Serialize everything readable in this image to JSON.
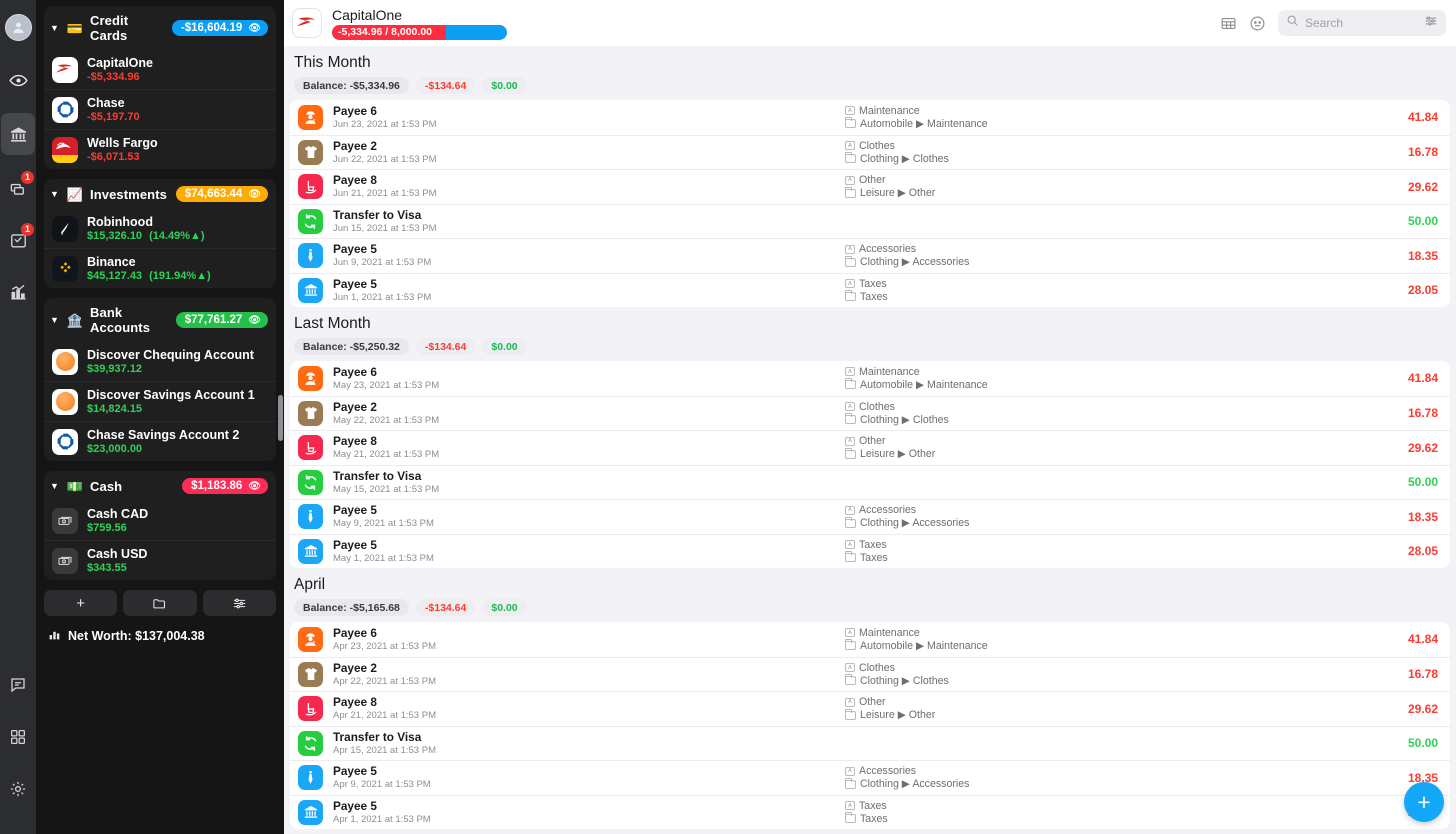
{
  "rail": {
    "avatar": "user-avatar",
    "items": [
      {
        "name": "eye",
        "badge": null
      },
      {
        "name": "bank",
        "badge": null,
        "active": true
      },
      {
        "name": "bills",
        "badge": "1"
      },
      {
        "name": "scheduled",
        "badge": "1"
      },
      {
        "name": "reports",
        "badge": null
      }
    ],
    "bottom": [
      {
        "name": "messages"
      },
      {
        "name": "widgets"
      },
      {
        "name": "settings"
      }
    ]
  },
  "sidebar": {
    "groups": [
      {
        "title": "Credit Cards",
        "emoji": "💳",
        "total": "-$16,604.19",
        "pill_color": "#0a9ff5",
        "accounts": [
          {
            "name": "CapitalOne",
            "balance": "-$5,334.96",
            "sign": "neg",
            "change": "",
            "logo": "capitalone"
          },
          {
            "name": "Chase",
            "balance": "-$5,197.70",
            "sign": "neg",
            "change": "",
            "logo": "chase"
          },
          {
            "name": "Wells Fargo",
            "balance": "-$6,071.53",
            "sign": "neg",
            "change": "",
            "logo": "wellsfargo"
          }
        ]
      },
      {
        "title": "Investments",
        "emoji": "📈",
        "total": "$74,663.44",
        "pill_color": "#ffab00",
        "accounts": [
          {
            "name": "Robinhood",
            "balance": "$15,326.10",
            "sign": "pos",
            "change": "(14.49%▲)",
            "logo": "robinhood"
          },
          {
            "name": "Binance",
            "balance": "$45,127.43",
            "sign": "pos",
            "change": "(191.94%▲)",
            "logo": "binance"
          }
        ]
      },
      {
        "title": "Bank Accounts",
        "emoji": "🏦",
        "total": "$77,761.27",
        "pill_color": "#24c04a",
        "accounts": [
          {
            "name": "Discover Chequing Account",
            "balance": "$39,937.12",
            "sign": "pos",
            "change": "",
            "logo": "discover"
          },
          {
            "name": "Discover Savings Account 1",
            "balance": "$14,824.15",
            "sign": "pos",
            "change": "",
            "logo": "discover"
          },
          {
            "name": "Chase Savings Account 2",
            "balance": "$23,000.00",
            "sign": "pos",
            "change": "",
            "logo": "chase"
          }
        ]
      },
      {
        "title": "Cash",
        "emoji": "💵",
        "total": "$1,183.86",
        "pill_color": "#ff2d55",
        "accounts": [
          {
            "name": "Cash CAD",
            "balance": "$759.56",
            "sign": "pos",
            "change": "",
            "logo": "cash"
          },
          {
            "name": "Cash USD",
            "balance": "$343.55",
            "sign": "pos",
            "change": "",
            "logo": "cash"
          }
        ]
      }
    ],
    "actions": [
      {
        "name": "add-account-button",
        "glyph": "+"
      },
      {
        "name": "folder-button",
        "glyph": "folder"
      },
      {
        "name": "filter-button",
        "glyph": "sliders"
      }
    ],
    "net_worth_label": "Net Worth: $137,004.38"
  },
  "header": {
    "account_name": "CapitalOne",
    "progress_label": "-5,334.96 / 8,000.00",
    "progress_percent": 65,
    "search_placeholder": "Search"
  },
  "sections": [
    {
      "title": "This Month",
      "balance_chip": "Balance: -$5,334.96",
      "spent_chip": "-$134.64",
      "income_chip": "$0.00",
      "transactions": [
        {
          "payee": "Payee 6",
          "date": "Jun 23, 2021 at 1:53 PM",
          "tag": "Maintenance",
          "category": "Automobile ▶ Maintenance",
          "amount": "41.84",
          "sign": "neg",
          "icon": "worker",
          "color": "#ff6a13"
        },
        {
          "payee": "Payee 2",
          "date": "Jun 22, 2021 at 1:53 PM",
          "tag": "Clothes",
          "category": "Clothing ▶ Clothes",
          "amount": "16.78",
          "sign": "neg",
          "icon": "shirt",
          "color": "#9b7b53"
        },
        {
          "payee": "Payee 8",
          "date": "Jun 21, 2021 at 1:53 PM",
          "tag": "Other",
          "category": "Leisure ▶ Other",
          "amount": "29.62",
          "sign": "neg",
          "icon": "chair",
          "color": "#f5294e"
        },
        {
          "payee": "Transfer to Visa",
          "date": "Jun 15, 2021 at 1:53 PM",
          "tag": "",
          "category": "",
          "amount": "50.00",
          "sign": "pos",
          "icon": "transfer",
          "color": "#26cd41"
        },
        {
          "payee": "Payee 5",
          "date": "Jun 9, 2021 at 1:53 PM",
          "tag": "Accessories",
          "category": "Clothing ▶ Accessories",
          "amount": "18.35",
          "sign": "neg",
          "icon": "tie",
          "color": "#1ba7f5"
        },
        {
          "payee": "Payee 5",
          "date": "Jun 1, 2021 at 1:53 PM",
          "tag": "Taxes",
          "category": "Taxes",
          "amount": "28.05",
          "sign": "neg",
          "icon": "bank",
          "color": "#1ba7f5"
        }
      ]
    },
    {
      "title": "Last Month",
      "balance_chip": "Balance: -$5,250.32",
      "spent_chip": "-$134.64",
      "income_chip": "$0.00",
      "transactions": [
        {
          "payee": "Payee 6",
          "date": "May 23, 2021 at 1:53 PM",
          "tag": "Maintenance",
          "category": "Automobile ▶ Maintenance",
          "amount": "41.84",
          "sign": "neg",
          "icon": "worker",
          "color": "#ff6a13"
        },
        {
          "payee": "Payee 2",
          "date": "May 22, 2021 at 1:53 PM",
          "tag": "Clothes",
          "category": "Clothing ▶ Clothes",
          "amount": "16.78",
          "sign": "neg",
          "icon": "shirt",
          "color": "#9b7b53"
        },
        {
          "payee": "Payee 8",
          "date": "May 21, 2021 at 1:53 PM",
          "tag": "Other",
          "category": "Leisure ▶ Other",
          "amount": "29.62",
          "sign": "neg",
          "icon": "chair",
          "color": "#f5294e"
        },
        {
          "payee": "Transfer to Visa",
          "date": "May 15, 2021 at 1:53 PM",
          "tag": "",
          "category": "",
          "amount": "50.00",
          "sign": "pos",
          "icon": "transfer",
          "color": "#26cd41"
        },
        {
          "payee": "Payee 5",
          "date": "May 9, 2021 at 1:53 PM",
          "tag": "Accessories",
          "category": "Clothing ▶ Accessories",
          "amount": "18.35",
          "sign": "neg",
          "icon": "tie",
          "color": "#1ba7f5"
        },
        {
          "payee": "Payee 5",
          "date": "May 1, 2021 at 1:53 PM",
          "tag": "Taxes",
          "category": "Taxes",
          "amount": "28.05",
          "sign": "neg",
          "icon": "bank",
          "color": "#1ba7f5"
        }
      ]
    },
    {
      "title": "April",
      "balance_chip": "Balance: -$5,165.68",
      "spent_chip": "-$134.64",
      "income_chip": "$0.00",
      "transactions": [
        {
          "payee": "Payee 6",
          "date": "Apr 23, 2021 at 1:53 PM",
          "tag": "Maintenance",
          "category": "Automobile ▶ Maintenance",
          "amount": "41.84",
          "sign": "neg",
          "icon": "worker",
          "color": "#ff6a13"
        },
        {
          "payee": "Payee 2",
          "date": "Apr 22, 2021 at 1:53 PM",
          "tag": "Clothes",
          "category": "Clothing ▶ Clothes",
          "amount": "16.78",
          "sign": "neg",
          "icon": "shirt",
          "color": "#9b7b53"
        },
        {
          "payee": "Payee 8",
          "date": "Apr 21, 2021 at 1:53 PM",
          "tag": "Other",
          "category": "Leisure ▶ Other",
          "amount": "29.62",
          "sign": "neg",
          "icon": "chair",
          "color": "#f5294e"
        },
        {
          "payee": "Transfer to Visa",
          "date": "Apr 15, 2021 at 1:53 PM",
          "tag": "",
          "category": "",
          "amount": "50.00",
          "sign": "pos",
          "icon": "transfer",
          "color": "#26cd41"
        },
        {
          "payee": "Payee 5",
          "date": "Apr 9, 2021 at 1:53 PM",
          "tag": "Accessories",
          "category": "Clothing ▶ Accessories",
          "amount": "18.35",
          "sign": "neg",
          "icon": "tie",
          "color": "#1ba7f5"
        },
        {
          "payee": "Payee 5",
          "date": "Apr 1, 2021 at 1:53 PM",
          "tag": "Taxes",
          "category": "Taxes",
          "amount": "28.05",
          "sign": "neg",
          "icon": "bank",
          "color": "#1ba7f5"
        }
      ]
    }
  ],
  "fab": {
    "label": "+"
  }
}
